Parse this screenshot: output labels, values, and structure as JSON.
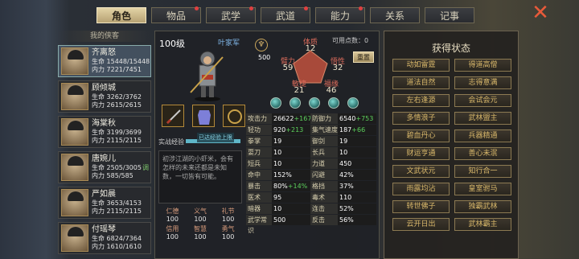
{
  "tabs": [
    {
      "label": "角色",
      "active": true,
      "dot": false
    },
    {
      "label": "物品",
      "active": false,
      "dot": true
    },
    {
      "label": "武学",
      "active": false,
      "dot": true
    },
    {
      "label": "武道",
      "active": false,
      "dot": true
    },
    {
      "label": "能力",
      "active": false,
      "dot": true
    },
    {
      "label": "关系",
      "active": false,
      "dot": false
    },
    {
      "label": "记事",
      "active": false,
      "dot": false
    }
  ],
  "close_icon": "close-x-icon",
  "roster": {
    "title": "我的侠客",
    "heroes": [
      {
        "name": "齐离怒",
        "hp": "生命 15448/15448",
        "mp": "内力 7221/7451",
        "flag": "",
        "selected": true
      },
      {
        "name": "顾倾城",
        "hp": "生命 3262/3762",
        "mp": "内力 2615/2615",
        "flag": "",
        "selected": false
      },
      {
        "name": "海棠秋",
        "hp": "生命 3199/3699",
        "mp": "内力 2115/2115",
        "flag": "",
        "selected": false
      },
      {
        "name": "唐婉儿",
        "hp": "生命 2505/3005",
        "mp": "内力 585/585",
        "flag": "调",
        "selected": false
      },
      {
        "name": "严如晨",
        "hp": "生命 3653/4153",
        "mp": "内力 2115/2115",
        "flag": "",
        "selected": false
      },
      {
        "name": "付瑶琴",
        "hp": "生命 6824/7364",
        "mp": "内力 1610/1610",
        "flag": "",
        "selected": false
      }
    ]
  },
  "character": {
    "level": "100级",
    "camp": "叶家军",
    "status_num": "500",
    "points_label": "可用点数：0",
    "reset_label": "重置",
    "attrs": {
      "tizhi": {
        "label": "体质",
        "value": "12"
      },
      "bili": {
        "label": "臂力",
        "value": "59"
      },
      "wuxing": {
        "label": "悟性",
        "value": "32"
      },
      "minjie": {
        "label": "敏捷",
        "value": "21"
      },
      "fuyuan": {
        "label": "福缘",
        "value": "46"
      }
    },
    "exp_label": "实战经验",
    "exp_text": "已达经验上限",
    "exp_fill": 1.0,
    "description": "初涉江湖的小虾米，会有怎样的未来还都是未知数，一切皆有可能。",
    "virtues": [
      {
        "label": "仁德",
        "value": "100"
      },
      {
        "label": "义气",
        "value": "100"
      },
      {
        "label": "礼节",
        "value": "100"
      },
      {
        "label": "信用",
        "value": "100"
      },
      {
        "label": "智慧",
        "value": "100"
      },
      {
        "label": "勇气",
        "value": "100"
      }
    ],
    "stats": [
      {
        "l1": "攻击力",
        "v1": "26622",
        "b1": "+1670",
        "l2": "防御力",
        "v2": "6540",
        "b2": "+753"
      },
      {
        "l1": "轻功",
        "v1": "920",
        "b1": "+213",
        "l2": "集气速度",
        "v2": "187",
        "b2": "+66"
      },
      {
        "l1": "拳掌",
        "v1": "19",
        "b1": "",
        "l2": "御剑",
        "v2": "19",
        "b2": ""
      },
      {
        "l1": "耍刀",
        "v1": "10",
        "b1": "",
        "l2": "长兵",
        "v2": "10",
        "b2": ""
      },
      {
        "l1": "短兵",
        "v1": "10",
        "b1": "",
        "l2": "力道",
        "v2": "450",
        "b2": ""
      },
      {
        "l1": "命中",
        "v1": "152%",
        "b1": "",
        "l2": "闪避",
        "v2": "42%",
        "b2": ""
      },
      {
        "l1": "暴击",
        "v1": "80%",
        "b1": "+14%",
        "l2": "格挡",
        "v2": "37%",
        "b2": ""
      },
      {
        "l1": "医术",
        "v1": "95",
        "b1": "",
        "l2": "毒术",
        "v2": "110",
        "b2": ""
      },
      {
        "l1": "暗器",
        "v1": "10",
        "b1": "",
        "l2": "连击",
        "v2": "52%",
        "b2": ""
      },
      {
        "l1": "武学常识",
        "v1": "500",
        "b1": "",
        "l2": "反击",
        "v2": "56%",
        "b2": ""
      }
    ]
  },
  "buffs": {
    "title": "获得状态",
    "items": [
      "动如雷霆",
      "得道高僧",
      "道法自然",
      "志得意满",
      "左右逢源",
      "会试会元",
      "多情浪子",
      "武林盟主",
      "碧血丹心",
      "兵器精通",
      "财运亨通",
      "善心未泯",
      "文武状元",
      "知行合一",
      "雨露均沾",
      "皇室驸马",
      "转世佛子",
      "独霸武林",
      "云开日出",
      "武林霸主"
    ]
  }
}
